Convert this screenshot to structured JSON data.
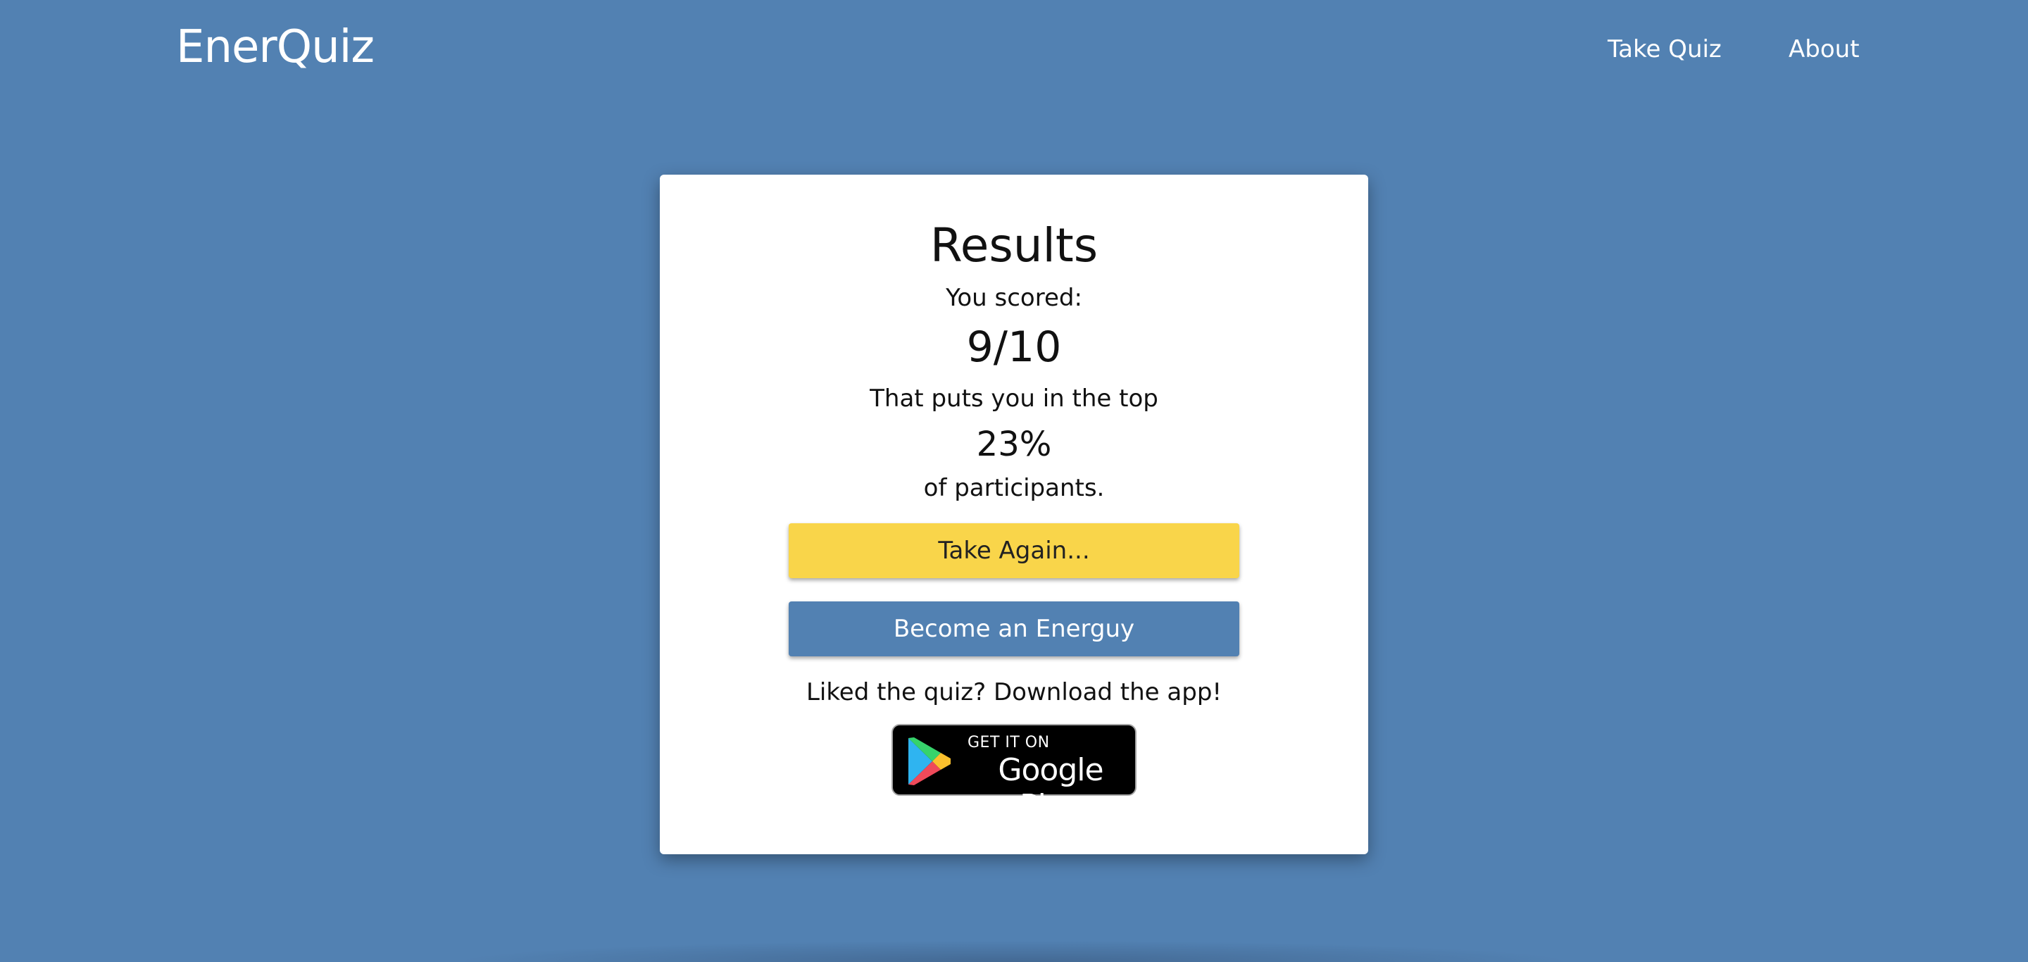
{
  "navbar": {
    "brand": "EnerQuiz",
    "links": [
      {
        "label": "Take Quiz"
      },
      {
        "label": "About"
      }
    ]
  },
  "results": {
    "title": "Results",
    "scored_label": "You scored:",
    "score": "9/10",
    "top_label": "That puts you in the top",
    "percent": "23%",
    "participants_label": "of participants.",
    "take_again_button": "Take Again...",
    "become_button": "Become an Energuy",
    "download_label": "Liked the quiz? Download the app!",
    "badge": {
      "small": "GET IT ON",
      "big": "Google Play"
    }
  },
  "colors": {
    "background": "#5281b2",
    "accent_yellow": "#f9d54a",
    "card": "#ffffff"
  }
}
